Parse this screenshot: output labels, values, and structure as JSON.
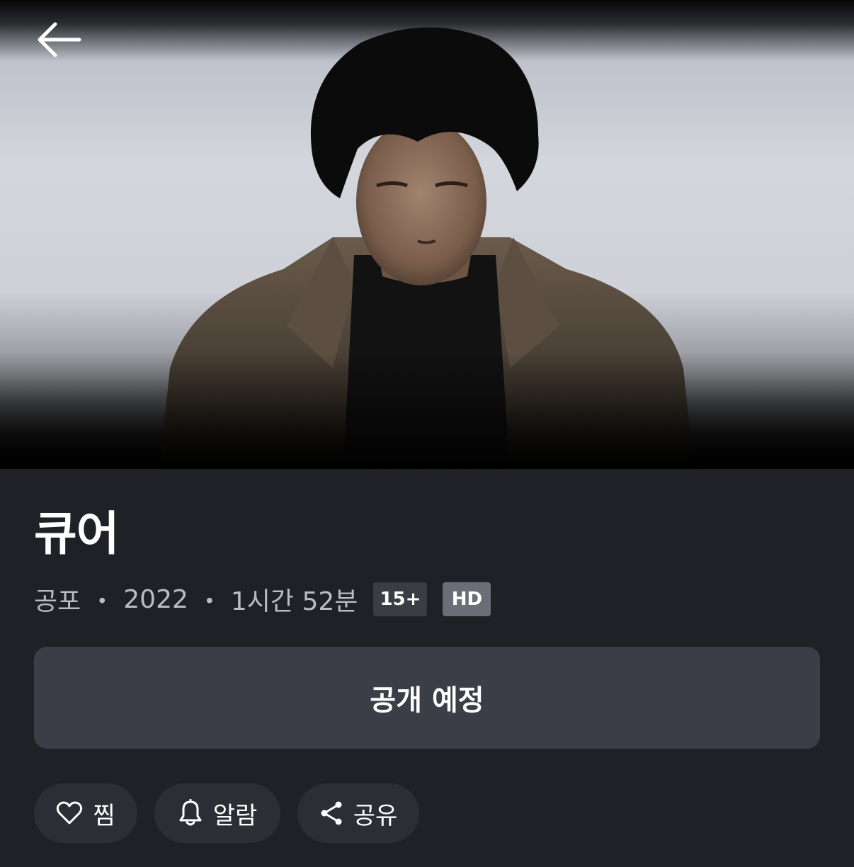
{
  "movie": {
    "title": "큐어",
    "genre": "공포",
    "separator": "・",
    "year": "2022",
    "runtime": "1시간 52분",
    "age_rating": "15+",
    "quality": "HD"
  },
  "primary_action": {
    "label": "공개 예정"
  },
  "actions": {
    "like_label": "찜",
    "alarm_label": "알람",
    "share_label": "공유"
  },
  "icons": {
    "back": "arrow-left-icon",
    "like": "heart-icon",
    "alarm": "bell-icon",
    "share": "share-icon"
  },
  "colors": {
    "background": "#1f2126",
    "button_bg": "#3b3e47",
    "pill_bg": "#2b2e35",
    "age_badge_bg": "#3a3d44",
    "hd_badge_bg": "#6b6e76",
    "meta_text": "#b9bcc3"
  }
}
